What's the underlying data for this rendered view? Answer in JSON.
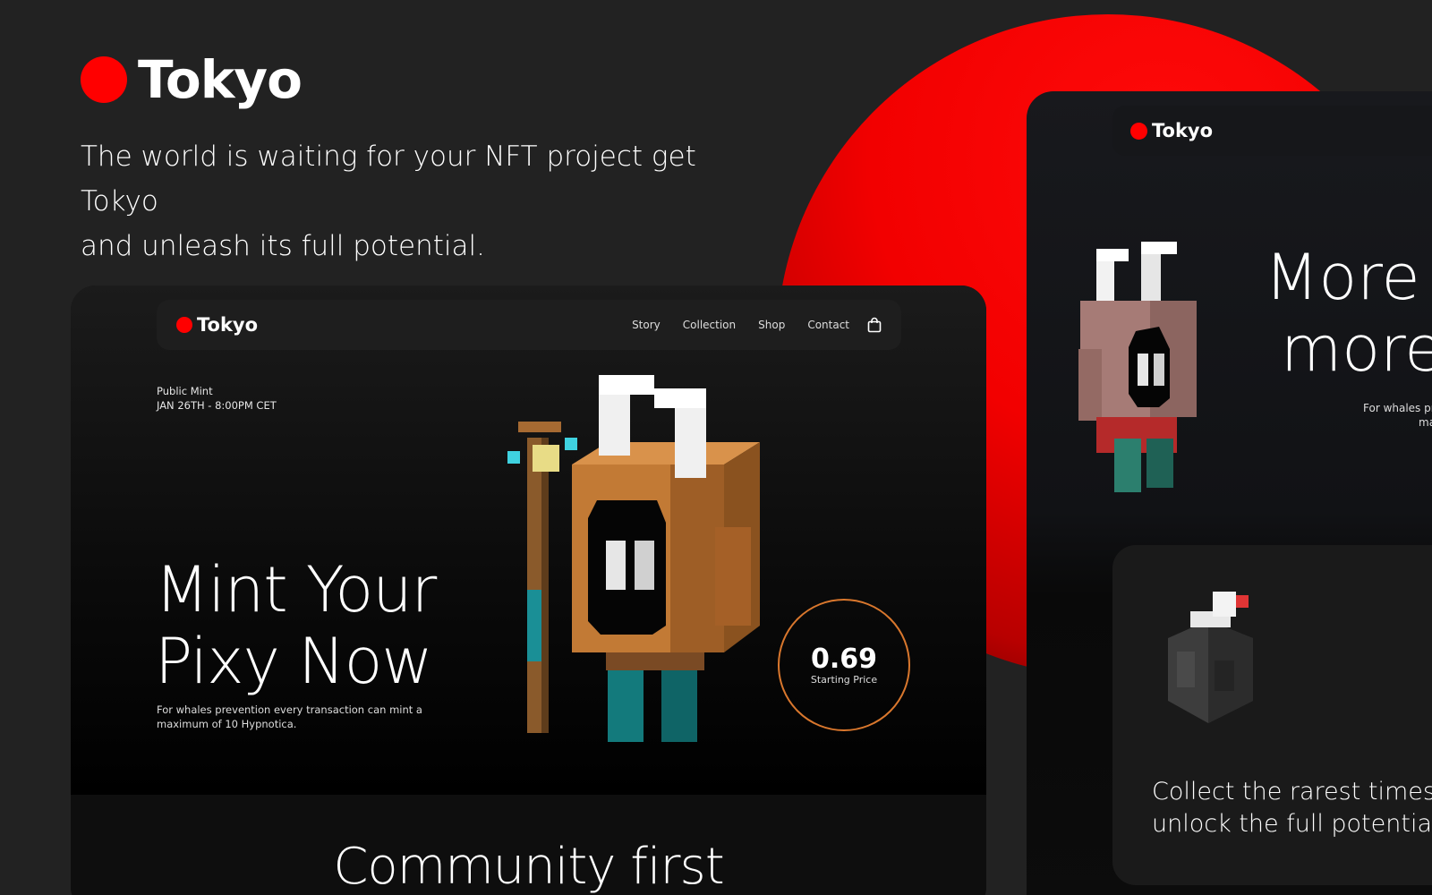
{
  "brand": {
    "name": "Tokyo",
    "accent": "#ff0000"
  },
  "tagline": {
    "line1": "The world is waiting for your NFT project get Tokyo",
    "line2": "and unleash its full potential."
  },
  "mock_main": {
    "nav": {
      "brand": "Tokyo",
      "links": [
        "Story",
        "Collection",
        "Shop",
        "Contact"
      ],
      "cart_icon": "shopping-bag-icon"
    },
    "mint_info": {
      "label": "Public Mint",
      "date": "JAN 26TH - 8:00PM CET"
    },
    "hero": {
      "title_line1": "Mint Your",
      "title_line2": "Pixy Now",
      "subtitle_line1": "For whales prevention every transaction can mint a",
      "subtitle_line2": "maximum of 10 Hypnotica."
    },
    "price": {
      "value": "0.69",
      "label": "Starting Price",
      "ring_color": "#d9772d"
    },
    "section2": {
      "title": "Community first"
    }
  },
  "mock_right": {
    "nav": {
      "brand": "Tokyo"
    },
    "hero": {
      "title_line1": "More",
      "title_line2": "more",
      "subtitle_line1": "For whales pre",
      "subtitle_line2": "ma"
    },
    "card": {
      "text_line1": "Collect the rarest times a",
      "text_line2": "unlock the full potential"
    }
  }
}
